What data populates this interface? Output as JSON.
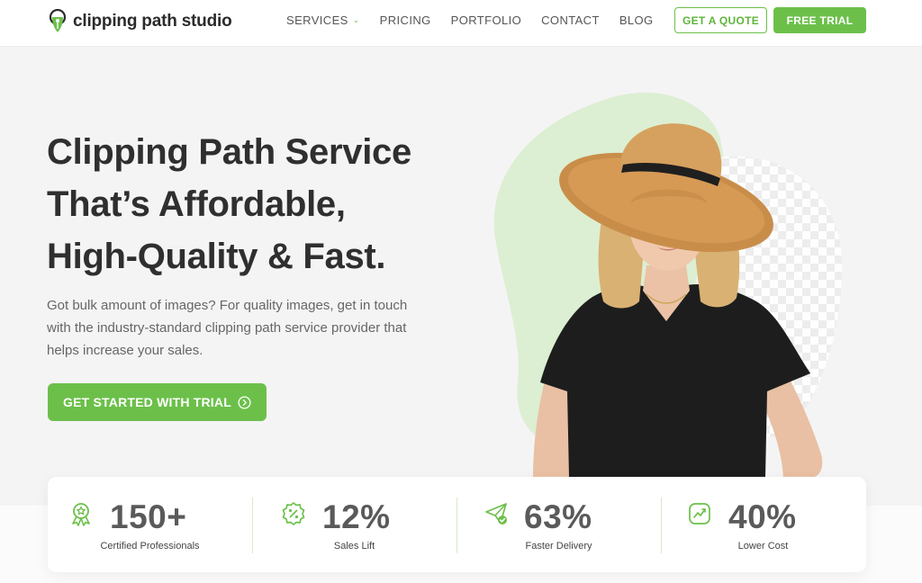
{
  "header": {
    "logo_text": "clipping path studio",
    "nav": [
      {
        "label": "SERVICES",
        "has_dropdown": true
      },
      {
        "label": "PRICING"
      },
      {
        "label": "PORTFOLIO"
      },
      {
        "label": "CONTACT"
      },
      {
        "label": "BLOG"
      }
    ],
    "quote_button": "GET A QUOTE",
    "trial_button": "FREE TRIAL"
  },
  "hero": {
    "title_lines": [
      "Clipping Path Service",
      "That’s Affordable,",
      "High-Quality & Fast."
    ],
    "description": "Got bulk amount of images? For quality images, get in touch with the industry-standard clipping path service provider that helps increase your sales.",
    "cta_label": "GET STARTED WITH TRIAL",
    "cta_icon": "chevron-circle-right-icon"
  },
  "stats": [
    {
      "value": "150+",
      "label": "Certified Professionals",
      "icon": "award-ribbon-icon"
    },
    {
      "value": "12%",
      "label": "Sales Lift",
      "icon": "discount-badge-icon"
    },
    {
      "value": "63%",
      "label": "Faster Delivery",
      "icon": "paper-plane-check-icon"
    },
    {
      "value": "40%",
      "label": "Lower Cost",
      "icon": "trend-chart-icon"
    }
  ],
  "colors": {
    "accent": "#6cc04a",
    "title": "#2f2f2f",
    "background": "#f4f4f5",
    "blob": "#dcefd2"
  }
}
